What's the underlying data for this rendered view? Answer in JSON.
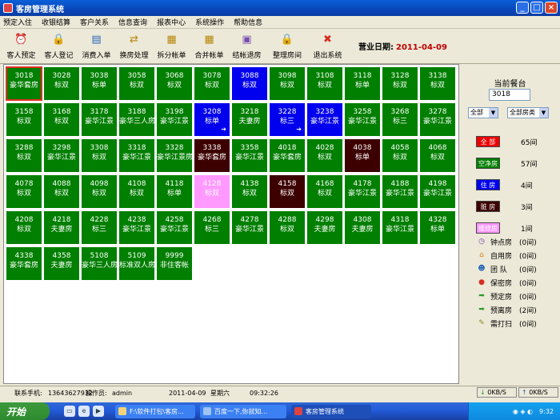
{
  "window": {
    "title": "客房管理系统",
    "min": "_",
    "max": "□",
    "close": "×"
  },
  "menu": [
    "预定入住",
    "收银结算",
    "客户关系",
    "信息查询",
    "报表中心",
    "系统操作",
    "帮助信息"
  ],
  "toolbar": {
    "buttons": [
      {
        "label": "客人预定",
        "icon": "alarm-clock-icon",
        "glyph": "⏰",
        "color": "#c0392b"
      },
      {
        "label": "客人登记",
        "icon": "user-lock-icon",
        "glyph": "🔒",
        "color": "#d4a017"
      },
      {
        "label": "消费入单",
        "icon": "printer-icon",
        "glyph": "▤",
        "color": "#2a66b8"
      },
      {
        "label": "换房处理",
        "icon": "door-swap-icon",
        "glyph": "⇄",
        "color": "#b8860b"
      },
      {
        "label": "拆分帐单",
        "icon": "split-bill-icon",
        "glyph": "▦",
        "color": "#b8860b"
      },
      {
        "label": "合并帐单",
        "icon": "merge-bill-icon",
        "glyph": "▦",
        "color": "#b8860b"
      },
      {
        "label": "结帐退房",
        "icon": "checkout-icon",
        "glyph": "▣",
        "color": "#7a4fb0"
      },
      {
        "label": "整理房间",
        "icon": "lock-icon",
        "glyph": "🔒",
        "color": "#d4a017"
      },
      {
        "label": "退出系统",
        "icon": "exit-icon",
        "glyph": "✖",
        "color": "#d62d20"
      }
    ],
    "business_date_label": "营业日期:",
    "business_date": "2011-04-09"
  },
  "colors": {
    "vacant_clean": "#007f00",
    "occupied": "#0000ee",
    "dirty": "#3d0000",
    "repair": "#ff99ff",
    "all": "#ee0000"
  },
  "rooms": [
    [
      {
        "n": "3018",
        "t": "豪华套房",
        "s": "vacant_clean",
        "sel": true
      },
      {
        "n": "3028",
        "t": "标双",
        "s": "vacant_clean"
      },
      {
        "n": "3038",
        "t": "标单",
        "s": "vacant_clean"
      },
      {
        "n": "3058",
        "t": "标双",
        "s": "vacant_clean"
      },
      {
        "n": "3068",
        "t": "标双",
        "s": "vacant_clean"
      },
      {
        "n": "3078",
        "t": "标双",
        "s": "vacant_clean"
      },
      {
        "n": "3088",
        "t": "标双",
        "s": "occupied"
      },
      {
        "n": "3098",
        "t": "标双",
        "s": "vacant_clean"
      },
      {
        "n": "3108",
        "t": "标双",
        "s": "vacant_clean"
      },
      {
        "n": "3118",
        "t": "标单",
        "s": "vacant_clean"
      },
      {
        "n": "3128",
        "t": "标双",
        "s": "vacant_clean"
      },
      {
        "n": "3138",
        "t": "标双",
        "s": "vacant_clean"
      }
    ],
    [
      {
        "n": "3158",
        "t": "标双",
        "s": "vacant_clean"
      },
      {
        "n": "3168",
        "t": "标双",
        "s": "vacant_clean"
      },
      {
        "n": "3178",
        "t": "豪华江景",
        "s": "vacant_clean"
      },
      {
        "n": "3188",
        "t": "豪华三人房",
        "s": "vacant_clean"
      },
      {
        "n": "3198",
        "t": "豪华江景",
        "s": "vacant_clean"
      },
      {
        "n": "3208",
        "t": "标单",
        "s": "occupied",
        "arrow": true
      },
      {
        "n": "3218",
        "t": "夫妻房",
        "s": "vacant_clean"
      },
      {
        "n": "3228",
        "t": "标三",
        "s": "occupied",
        "arrow": true
      },
      {
        "n": "3238",
        "t": "豪华江景",
        "s": "occupied"
      },
      {
        "n": "3258",
        "t": "豪华江景",
        "s": "vacant_clean"
      },
      {
        "n": "3268",
        "t": "标三",
        "s": "vacant_clean"
      },
      {
        "n": "3278",
        "t": "豪华江景",
        "s": "vacant_clean"
      }
    ],
    [
      {
        "n": "3288",
        "t": "标双",
        "s": "vacant_clean"
      },
      {
        "n": "3298",
        "t": "豪华江景",
        "s": "vacant_clean"
      },
      {
        "n": "3308",
        "t": "标双",
        "s": "vacant_clean"
      },
      {
        "n": "3318",
        "t": "豪华江景",
        "s": "vacant_clean"
      },
      {
        "n": "3328",
        "t": "豪华江景房",
        "s": "vacant_clean"
      },
      {
        "n": "3338",
        "t": "豪华套房",
        "s": "dirty"
      },
      {
        "n": "3358",
        "t": "豪华江景",
        "s": "vacant_clean"
      },
      {
        "n": "4018",
        "t": "豪华套房",
        "s": "vacant_clean"
      },
      {
        "n": "4028",
        "t": "标双",
        "s": "vacant_clean"
      },
      {
        "n": "4038",
        "t": "标单",
        "s": "dirty"
      },
      {
        "n": "4058",
        "t": "标双",
        "s": "vacant_clean"
      },
      {
        "n": "4068",
        "t": "标双",
        "s": "vacant_clean"
      }
    ],
    [
      {
        "n": "4078",
        "t": "标双",
        "s": "vacant_clean"
      },
      {
        "n": "4088",
        "t": "标双",
        "s": "vacant_clean"
      },
      {
        "n": "4098",
        "t": "标双",
        "s": "vacant_clean"
      },
      {
        "n": "4108",
        "t": "标双",
        "s": "vacant_clean"
      },
      {
        "n": "4118",
        "t": "标单",
        "s": "vacant_clean"
      },
      {
        "n": "4128",
        "t": "标双",
        "s": "repair"
      },
      {
        "n": "4138",
        "t": "标双",
        "s": "vacant_clean"
      },
      {
        "n": "4158",
        "t": "标双",
        "s": "dirty"
      },
      {
        "n": "4168",
        "t": "标双",
        "s": "vacant_clean"
      },
      {
        "n": "4178",
        "t": "豪华江景",
        "s": "vacant_clean"
      },
      {
        "n": "4188",
        "t": "豪华江景",
        "s": "vacant_clean"
      },
      {
        "n": "4198",
        "t": "豪华江景",
        "s": "vacant_clean"
      }
    ],
    [
      {
        "n": "4208",
        "t": "标双",
        "s": "vacant_clean"
      },
      {
        "n": "4218",
        "t": "夫妻房",
        "s": "vacant_clean"
      },
      {
        "n": "4228",
        "t": "标三",
        "s": "vacant_clean"
      },
      {
        "n": "4238",
        "t": "豪华江景",
        "s": "vacant_clean"
      },
      {
        "n": "4258",
        "t": "豪华江景",
        "s": "vacant_clean"
      },
      {
        "n": "4268",
        "t": "标三",
        "s": "vacant_clean"
      },
      {
        "n": "4278",
        "t": "豪华江景",
        "s": "vacant_clean"
      },
      {
        "n": "4288",
        "t": "标双",
        "s": "vacant_clean"
      },
      {
        "n": "4298",
        "t": "夫妻房",
        "s": "vacant_clean"
      },
      {
        "n": "4308",
        "t": "夫妻房",
        "s": "vacant_clean"
      },
      {
        "n": "4318",
        "t": "豪华江景",
        "s": "vacant_clean"
      },
      {
        "n": "4328",
        "t": "标单",
        "s": "vacant_clean"
      }
    ],
    [
      {
        "n": "4338",
        "t": "豪华套房",
        "s": "vacant_clean"
      },
      {
        "n": "4358",
        "t": "夫妻房",
        "s": "vacant_clean"
      },
      {
        "n": "5108",
        "t": "豪华三人房",
        "s": "vacant_clean"
      },
      {
        "n": "5109",
        "t": "标准双人房",
        "s": "vacant_clean"
      },
      {
        "n": "9999",
        "t": "非住客帐",
        "s": "vacant_clean"
      }
    ]
  ],
  "panel": {
    "header": "当前餐台",
    "room_input": "3018",
    "filter_floor": "全部",
    "filter_type": "全部房类",
    "legend": [
      {
        "label": "全 部",
        "count": "65间",
        "status": "all"
      },
      {
        "label": "空净房",
        "count": "57间",
        "status": "vacant_clean"
      },
      {
        "label": "住 房",
        "count": "4间",
        "status": "occupied"
      },
      {
        "label": "脏 房",
        "count": "3间",
        "status": "dirty"
      },
      {
        "label": "维修房",
        "count": "1间",
        "status": "repair"
      }
    ],
    "flags": [
      {
        "label": "钟点房",
        "count": "(0间)",
        "icon": "clock-icon",
        "glyph": "◷",
        "color": "#7a3fb0"
      },
      {
        "label": "自用房",
        "count": "(0间)",
        "icon": "house-icon",
        "glyph": "⌂",
        "color": "#e07a10"
      },
      {
        "label": "团 队",
        "count": "(0间)",
        "icon": "team-icon",
        "glyph": "☻",
        "color": "#2a66b8"
      },
      {
        "label": "保密房",
        "count": "(0间)",
        "icon": "secret-icon",
        "glyph": "●",
        "color": "#d62d20"
      },
      {
        "label": "预定房",
        "count": "(0间)",
        "icon": "arrow-in-icon",
        "glyph": "➡",
        "color": "#2a9a2a"
      },
      {
        "label": "预离房",
        "count": "(2间)",
        "icon": "arrow-out-icon",
        "glyph": "➡",
        "color": "#2a9a2a"
      },
      {
        "label": "需打扫",
        "count": "(0间)",
        "icon": "broom-icon",
        "glyph": "✎",
        "color": "#8a8a20"
      }
    ]
  },
  "status": {
    "phone_label": "联系手机:",
    "phone": "13643627932",
    "operator_label": "操作员:",
    "operator": "admin",
    "date": "2011-04-09",
    "weekday": "星期六",
    "time": "09:32:26",
    "net_down": "0KB/S",
    "net_up": "0KB/S"
  },
  "taskbar": {
    "start": "开始",
    "tasks": [
      {
        "label": "F:\\软件打包\\客房..."
      },
      {
        "label": "百度一下,你就知..."
      },
      {
        "label": "客房管理系统",
        "active": true
      }
    ],
    "clock": "9:32"
  }
}
